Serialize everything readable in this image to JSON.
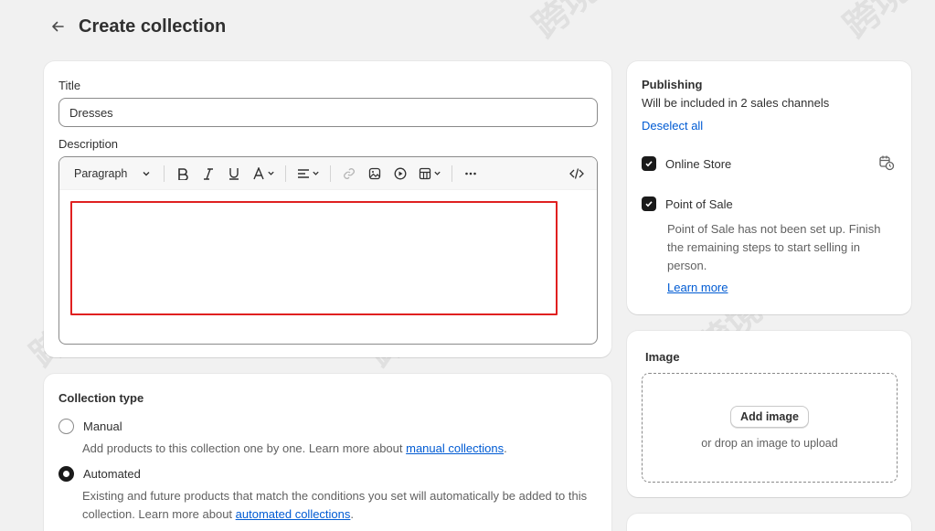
{
  "header": {
    "title": "Create collection"
  },
  "main": {
    "title_label": "Title",
    "title_value": "Dresses",
    "description_label": "Description",
    "toolbar": {
      "paragraph_label": "Paragraph"
    }
  },
  "collection_type": {
    "title": "Collection type",
    "manual_label": "Manual",
    "manual_help_prefix": "Add products to this collection one by one. Learn more about ",
    "manual_help_link": "manual collections",
    "manual_help_suffix": ".",
    "automated_label": "Automated",
    "automated_help_prefix": "Existing and future products that match the conditions you set will automatically be added to this collection. Learn more about ",
    "automated_help_link": "automated collections",
    "automated_help_suffix": ".",
    "selected": "Automated"
  },
  "publishing": {
    "title": "Publishing",
    "subtitle": "Will be included in 2 sales channels",
    "deselect_all": "Deselect all",
    "channels": [
      {
        "label": "Online Store",
        "checked": true
      },
      {
        "label": "Point of Sale",
        "checked": true
      }
    ],
    "pos_note": "Point of Sale has not been set up. Finish the remaining steps to start selling in person.",
    "learn_more": "Learn more"
  },
  "image": {
    "title": "Image",
    "add_button": "Add image",
    "drop_hint": "or drop an image to upload"
  },
  "watermark_text": "跨境出海陆路",
  "colors": {
    "link": "#005bd3",
    "highlight_box": "#e02020",
    "background": "#f1f1f1"
  }
}
